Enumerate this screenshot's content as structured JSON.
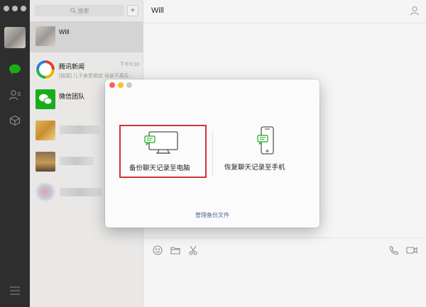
{
  "colors": {
    "rail": "#2e2e2e",
    "wechat_green": "#1aad19",
    "highlight_red": "#d0343a",
    "link_blue": "#4d6a9a"
  },
  "sidebar": {
    "icons": [
      "chat-icon",
      "contacts-icon",
      "favorites-icon",
      "menu-icon"
    ]
  },
  "search": {
    "placeholder": "搜索"
  },
  "chat_list": [
    {
      "name": "Will",
      "time": "",
      "preview": "",
      "selected": true
    },
    {
      "name": "腾讯新闻",
      "time": "下午5:10",
      "preview": "[链接] 儿子身患癌症 母亲不离反...",
      "selected": false
    },
    {
      "name": "微信团队",
      "time": "",
      "preview": "",
      "selected": false
    }
  ],
  "main": {
    "title": "Will"
  },
  "dialog": {
    "backup_label": "备份聊天记录至电脑",
    "restore_label": "恢复聊天记录至手机",
    "manage_link": "管理备份文件"
  },
  "toolbar_icons": [
    "emoji-icon",
    "folder-icon",
    "scissors-icon",
    "phone-icon",
    "video-icon"
  ]
}
